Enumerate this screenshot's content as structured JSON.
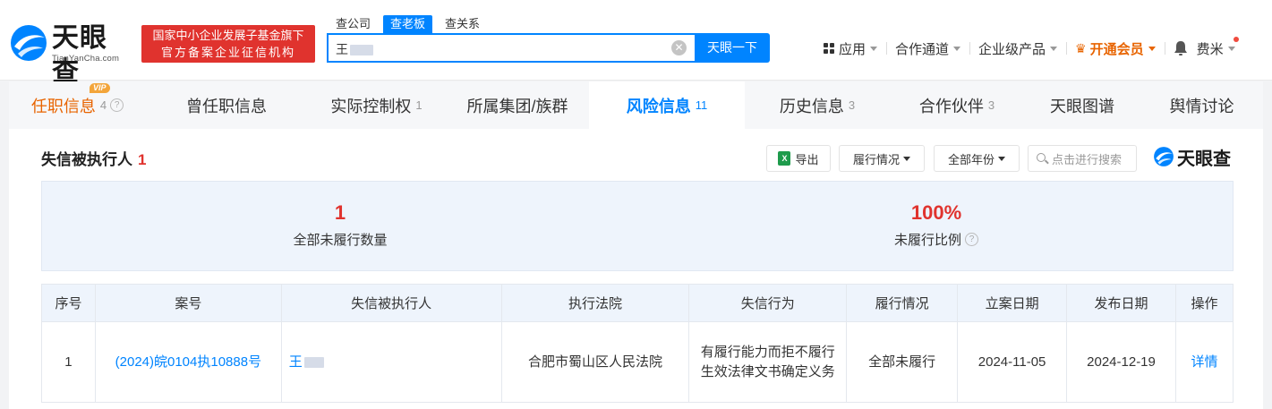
{
  "header": {
    "logo_text": "天眼查",
    "logo_sub": "TianYanCha.com",
    "banner_line1": "国家中小企业发展子基金旗下",
    "banner_line2": "官方备案企业征信机构",
    "search_tabs": [
      "查公司",
      "查老板",
      "查关系"
    ],
    "search_value": "王",
    "search_button": "天眼一下",
    "nav": {
      "apps": "应用",
      "partner": "合作通道",
      "enterprise": "企业级产品",
      "vip": "开通会员",
      "user": "费米"
    }
  },
  "tabs": [
    {
      "label": "任职信息",
      "count": "4"
    },
    {
      "label": "曾任职信息",
      "count": ""
    },
    {
      "label": "实际控制权",
      "count": "1"
    },
    {
      "label": "所属集团/族群",
      "count": ""
    },
    {
      "label": "风险信息",
      "count": "11"
    },
    {
      "label": "历史信息",
      "count": "3"
    },
    {
      "label": "合作伙伴",
      "count": "3"
    },
    {
      "label": "天眼图谱",
      "count": ""
    },
    {
      "label": "舆情讨论",
      "count": ""
    }
  ],
  "vip_badge": "VIP",
  "section": {
    "title": "失信被执行人",
    "count": "1",
    "export": "导出",
    "filter_status": "履行情况",
    "filter_year": "全部年份",
    "search_placeholder": "点击进行搜索",
    "brand": "天眼查"
  },
  "stats": [
    {
      "value": "1",
      "label": "全部未履行数量"
    },
    {
      "value": "100%",
      "label": "未履行比例"
    }
  ],
  "table": {
    "headers": [
      "序号",
      "案号",
      "失信被执行人",
      "执行法院",
      "失信行为",
      "履行情况",
      "立案日期",
      "发布日期",
      "操作"
    ],
    "rows": [
      {
        "index": "1",
        "case_no": "(2024)皖0104执10888号",
        "person": "王",
        "court": "合肥市蜀山区人民法院",
        "behavior": "有履行能力而拒不履行生效法律文书确定义务",
        "status": "全部未履行",
        "filed": "2024-11-05",
        "published": "2024-12-19",
        "action": "详情"
      }
    ]
  },
  "colors": {
    "accent": "#0084ff",
    "alert": "#e0332e",
    "vip": "#e86400"
  }
}
